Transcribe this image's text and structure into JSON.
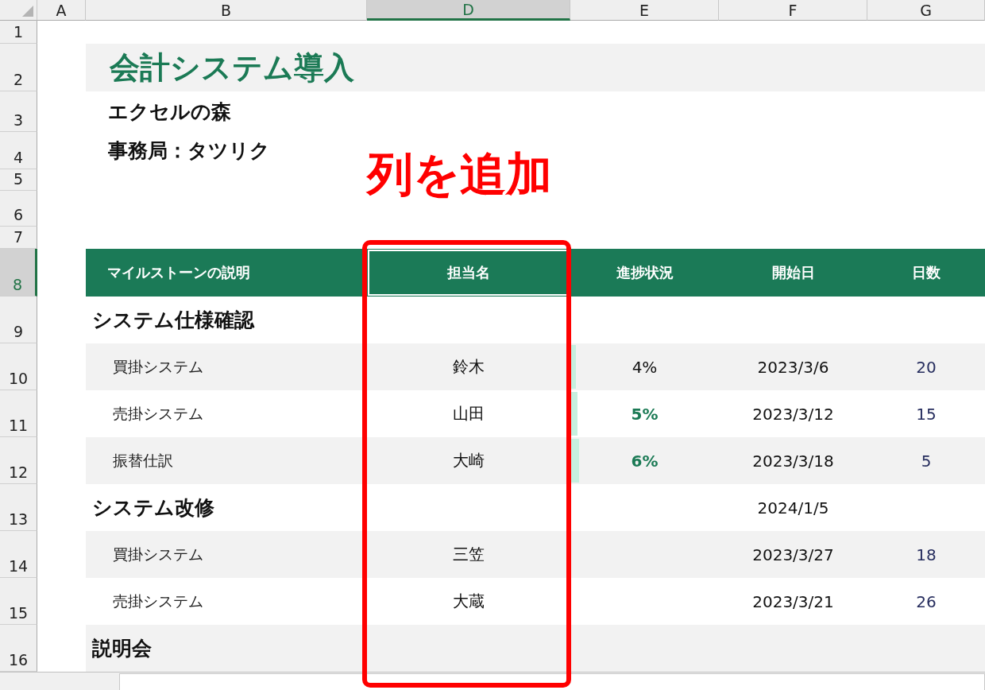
{
  "column_headers": [
    {
      "label": "A",
      "selected": false
    },
    {
      "label": "B",
      "selected": false
    },
    {
      "label": "D",
      "selected": true
    },
    {
      "label": "E",
      "selected": false
    },
    {
      "label": "F",
      "selected": false
    },
    {
      "label": "G",
      "selected": false
    }
  ],
  "row_numbers": [
    {
      "label": "1",
      "selected": false
    },
    {
      "label": "2",
      "selected": false
    },
    {
      "label": "3",
      "selected": false
    },
    {
      "label": "4",
      "selected": false
    },
    {
      "label": "5",
      "selected": false
    },
    {
      "label": "6",
      "selected": false
    },
    {
      "label": "7",
      "selected": false
    },
    {
      "label": "8",
      "selected": true
    },
    {
      "label": "9",
      "selected": false
    },
    {
      "label": "10",
      "selected": false
    },
    {
      "label": "11",
      "selected": false
    },
    {
      "label": "12",
      "selected": false
    },
    {
      "label": "13",
      "selected": false
    },
    {
      "label": "14",
      "selected": false
    },
    {
      "label": "15",
      "selected": false
    },
    {
      "label": "16",
      "selected": false
    }
  ],
  "title": "会計システム導入",
  "subtitle": "エクセルの森",
  "office": "事務局：タツリク",
  "table": {
    "columns": [
      {
        "label": "マイルストーンの説明",
        "selected": false
      },
      {
        "label": "担当名",
        "selected": true
      },
      {
        "label": "進捗状況",
        "selected": false
      },
      {
        "label": "開始日",
        "selected": false
      },
      {
        "label": "日数",
        "selected": false
      }
    ],
    "rows": [
      {
        "kind": "section",
        "name": "システム仕様確認",
        "shaded": false
      },
      {
        "kind": "task",
        "name": "買掛システム",
        "owner": "鈴木",
        "progress": "4%",
        "level": 0.04,
        "highlight": false,
        "start": "2023/3/6",
        "days": "20",
        "shaded": true
      },
      {
        "kind": "task",
        "name": "売掛システム",
        "owner": "山田",
        "progress": "5%",
        "level": 0.05,
        "highlight": true,
        "start": "2023/3/12",
        "days": "15",
        "shaded": false
      },
      {
        "kind": "task",
        "name": "振替仕訳",
        "owner": "大崎",
        "progress": "6%",
        "level": 0.06,
        "highlight": true,
        "start": "2023/3/18",
        "days": "5",
        "shaded": true
      },
      {
        "kind": "section",
        "name": "システム改修",
        "start": "2024/1/5",
        "shaded": false
      },
      {
        "kind": "task",
        "name": "買掛システム",
        "owner": "三笠",
        "start": "2023/3/27",
        "days": "18",
        "shaded": true
      },
      {
        "kind": "task",
        "name": "売掛システム",
        "owner": "大蔵",
        "start": "2023/3/21",
        "days": "26",
        "shaded": false
      },
      {
        "kind": "section",
        "name": "説明会",
        "shaded": true
      }
    ]
  },
  "annotation": {
    "label": "列を追加"
  }
}
